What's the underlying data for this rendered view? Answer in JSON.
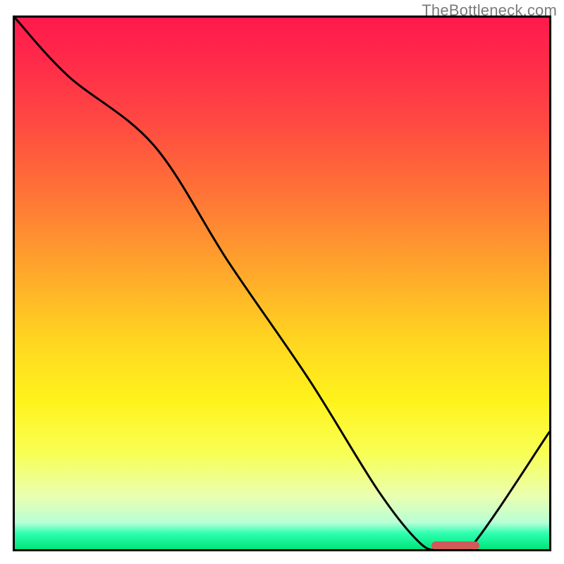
{
  "watermark": "TheBottleneck.com",
  "colors": {
    "border": "#000000",
    "curve": "#000000",
    "marker": "#d05a5a"
  },
  "chart_data": {
    "type": "line",
    "title": "",
    "xlabel": "",
    "ylabel": "",
    "xlim": [
      0,
      100
    ],
    "ylim": [
      0,
      100
    ],
    "background_gradient": {
      "orientation": "vertical",
      "stops": [
        {
          "pct": 0,
          "meaning": "worst",
          "color": "#ff1a4c"
        },
        {
          "pct": 50,
          "meaning": "mid",
          "color": "#ffd321"
        },
        {
          "pct": 95,
          "meaning": "good",
          "color": "#b8ffd6"
        },
        {
          "pct": 100,
          "meaning": "best",
          "color": "#00e57a"
        }
      ]
    },
    "series": [
      {
        "name": "bottleneck-curve",
        "x": [
          0,
          10,
          26,
          40,
          55,
          68,
          76,
          80,
          85,
          100
        ],
        "y": [
          100,
          89,
          76,
          54,
          32,
          11,
          1,
          0,
          0,
          22
        ]
      }
    ],
    "marker_range_x": [
      78,
      87
    ]
  }
}
